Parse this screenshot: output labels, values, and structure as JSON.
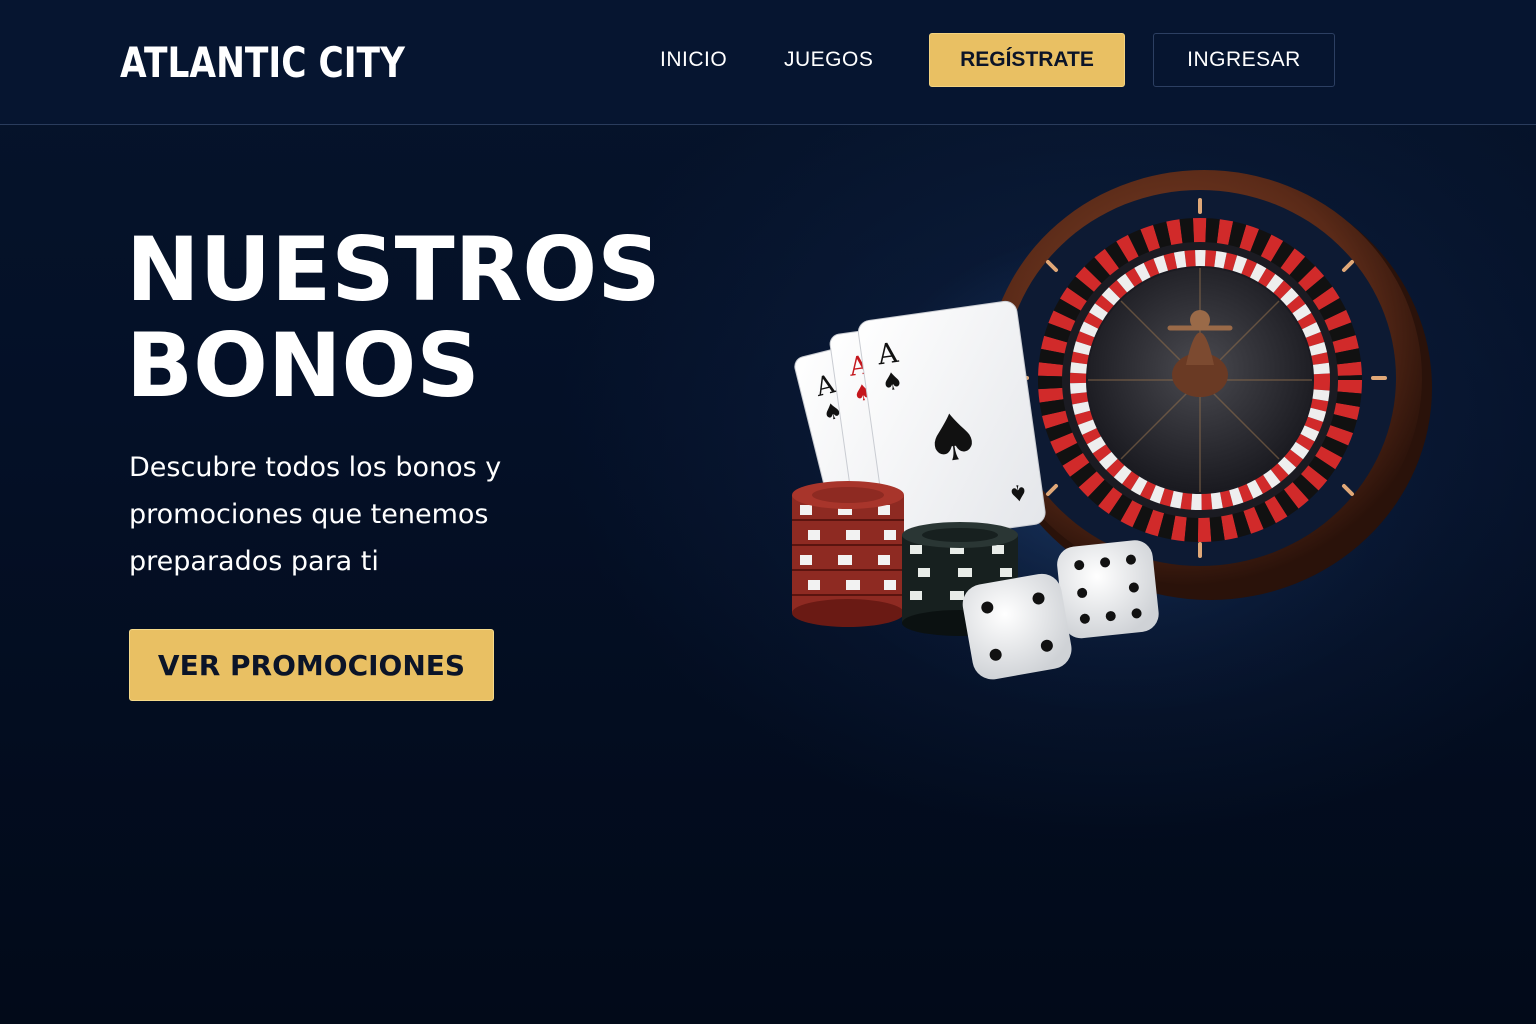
{
  "header": {
    "brand": "ATLANTIC CITY",
    "nav": {
      "inicio": "INICIO",
      "juegos": "JUEGOS"
    },
    "register_label": "REGÍSTRATE",
    "login_label": "INGRESAR"
  },
  "hero": {
    "title_line1": "NUESTROS",
    "title_line2": "BONOS",
    "subtitle": "Descubre todos los bonos y promociones que tenemos preparados para ti",
    "cta_label": "VER PROMOCIONES"
  },
  "art": {
    "items": [
      "roulette-wheel",
      "playing-cards-aces",
      "red-chip-stack",
      "black-chip-stack",
      "dice-pair"
    ]
  },
  "colors": {
    "accent_gold": "#e9c063",
    "background_navy": "#061530",
    "text_white": "#ffffff"
  }
}
